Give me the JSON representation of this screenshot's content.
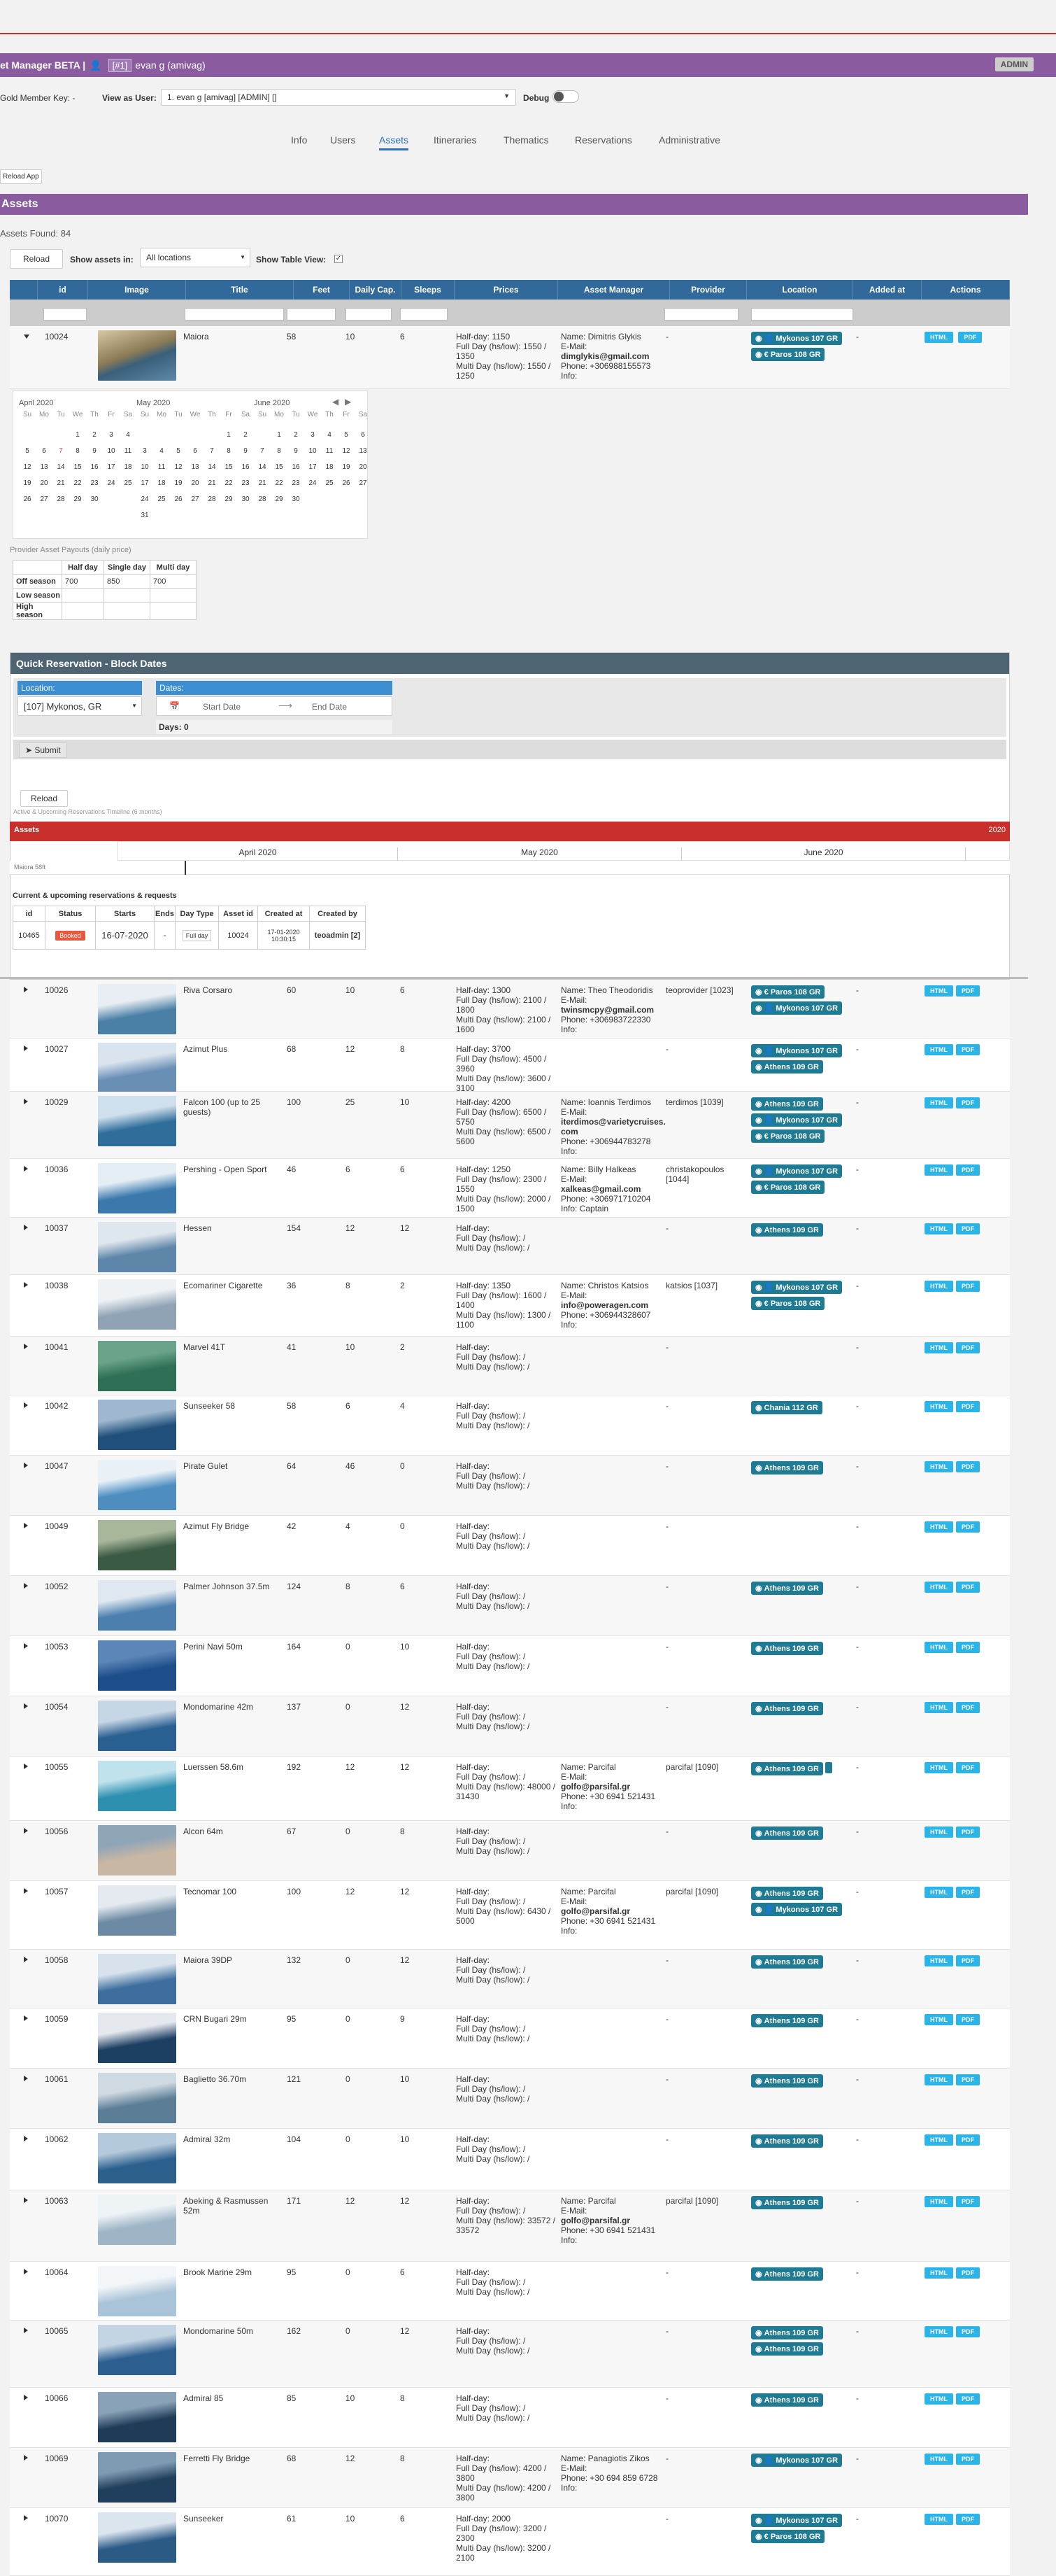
{
  "header": {
    "app_title": "et Manager BETA |",
    "user_tag": "[#1]",
    "user_name": "evan g (amivag)",
    "admin_badge": "ADMIN"
  },
  "controls": {
    "member_key_label": "Gold Member Key: -",
    "view_as_label": "View as User:",
    "view_as_value": "1. evan g [amivag] [ADMIN] []",
    "debug_label": "Debug"
  },
  "nav": {
    "tabs": [
      "Info",
      "Users",
      "Assets",
      "Itineraries",
      "Thematics",
      "Reservations",
      "Administrative"
    ],
    "active": "Assets",
    "reload_app": "Reload App"
  },
  "assets": {
    "section_title": "Assets",
    "found": "Assets Found: 84",
    "reload": "Reload",
    "show_in_label": "Show assets in:",
    "show_in_value": "All locations",
    "table_view_label": "Show Table View:"
  },
  "table": {
    "columns": [
      "id",
      "Image",
      "Title",
      "Feet",
      "Daily Cap.",
      "Sleeps",
      "Prices",
      "Asset Manager",
      "Provider",
      "Location",
      "Added at",
      "Actions"
    ],
    "btn_html": "HTML",
    "btn_pdf": "PDF"
  },
  "expanded": {
    "id": "10024",
    "title": "Maiora",
    "feet": "58",
    "cap": "10",
    "sleeps": "6",
    "prices": {
      "half": "Half-day: 1150",
      "full": "Full Day (hs/low): 1550 / 1350",
      "multi": "Multi Day (hs/low): 1550 / 1250"
    },
    "manager": {
      "name": "Name: Dimitris Glykis",
      "email_l": "E-Mail:",
      "email": "dimglykis@gmail.com",
      "phone": "Phone: +306988155573",
      "info": "Info:"
    },
    "provider": "-",
    "locations": [
      "Mykonos 107 GR",
      "Paros 108 GR"
    ],
    "added": "-"
  },
  "calendar": {
    "months": [
      {
        "name": "April 2020",
        "lead": 3,
        "days": 30,
        "red": [
          7
        ]
      },
      {
        "name": "May 2020",
        "lead": 5,
        "days": 31,
        "red": []
      },
      {
        "name": "June 2020",
        "lead": 1,
        "days": 30,
        "red": []
      }
    ],
    "weekdays": [
      "Su",
      "Mo",
      "Tu",
      "We",
      "Th",
      "Fr",
      "Sa"
    ]
  },
  "payouts": {
    "title": "Provider Asset Payouts (daily price)",
    "cols": [
      "",
      "Half day",
      "Single day",
      "Multi day"
    ],
    "rows": [
      [
        "Off season",
        "700",
        "850",
        "700"
      ],
      [
        "Low season",
        "",
        "",
        ""
      ],
      [
        "High season",
        "",
        "",
        ""
      ]
    ]
  },
  "quick_res": {
    "title": "Quick Reservation - Block Dates",
    "location_label": "Location:",
    "location_value": "[107] Mykonos, GR",
    "dates_label": "Dates:",
    "start": "Start Date",
    "end": "End Date",
    "days": "Days: 0",
    "submit": "Submit"
  },
  "timeline": {
    "reload": "Reload",
    "caption": "Active & Upcoming Reservations Timeline (6 months)",
    "assets_label": "Assets",
    "year": "2020",
    "months": [
      "April 2020",
      "May 2020",
      "June 2020"
    ],
    "asset_row": "Maiora 58ft"
  },
  "reservations": {
    "title": "Current & upcoming reservations & requests",
    "cols": [
      "id",
      "Status",
      "Starts",
      "Ends",
      "Day Type",
      "Asset id",
      "Created at",
      "Created by"
    ],
    "row": [
      "10465",
      "Booked",
      "16-07-2020",
      "-",
      "Full day",
      "10024",
      "17-01-2020 10:30:15",
      "teoadmin [2]"
    ]
  },
  "rows": [
    {
      "id": "10026",
      "title": "Riva Corsaro",
      "feet": "60",
      "cap": "10",
      "sleeps": "6",
      "half": "Half-day: 1300",
      "full": "Full Day (hs/low): 2100 / 1800",
      "multi": "Multi Day (hs/low): 2100 / 1600",
      "mgr": [
        "Name: Theo Theodoridis",
        "E-Mail:",
        "twinsmcpy@gmail.com",
        "Phone: +306983722330",
        "Info:"
      ],
      "prov": "teoprovider [1023]",
      "locs": [
        "Paros 108 GR",
        "Mykonos 107 GR"
      ],
      "img": [
        "#4a7fa6",
        "#e8eef3"
      ]
    },
    {
      "id": "10027",
      "title": "Azimut Plus",
      "feet": "68",
      "cap": "12",
      "sleeps": "8",
      "half": "Half-day: 3700",
      "full": "Full Day (hs/low): 4500 / 3960",
      "multi": "Multi Day (hs/low): 3600 / 3100",
      "mgr": [],
      "prov": "-",
      "locs": [
        "Mykonos 107 GR",
        "Athens 109 GR"
      ],
      "img": [
        "#6a8fb5",
        "#d9e4ee"
      ]
    },
    {
      "id": "10029",
      "title": "Falcon 100 (up to 25 guests)",
      "feet": "100",
      "cap": "25",
      "sleeps": "10",
      "half": "Half-day: 4200",
      "full": "Full Day (hs/low): 6500 / 5750",
      "multi": "Multi Day (hs/low): 6500 / 5600",
      "mgr": [
        "Name: Ioannis Terdimos",
        "E-Mail:",
        "iterdimos@varietycruises.com",
        "Phone: +306944783278",
        "Info:"
      ],
      "prov": "terdimos [1039]",
      "locs": [
        "Athens 109 GR",
        "Mykonos 107 GR",
        "Paros 108 GR"
      ],
      "img": [
        "#2f6d9a",
        "#cfe0ec"
      ]
    },
    {
      "id": "10036",
      "title": "Pershing - Open Sport",
      "feet": "46",
      "cap": "6",
      "sleeps": "6",
      "half": "Half-day: 1250",
      "full": "Full Day (hs/low): 2300 / 1550",
      "multi": "Multi Day (hs/low): 2000 / 1500",
      "mgr": [
        "Name: Billy Halkeas",
        "E-Mail:",
        "xalkeas@gmail.com",
        "Phone: +306971710204",
        "Info: Captain"
      ],
      "prov": "christakopoulos [1044]",
      "locs": [
        "Mykonos 107 GR",
        "Paros 108 GR"
      ],
      "img": [
        "#3b79ad",
        "#e6eef5"
      ]
    },
    {
      "id": "10037",
      "title": "Hessen",
      "feet": "154",
      "cap": "12",
      "sleeps": "12",
      "half": "Half-day:",
      "full": "Full Day (hs/low): /",
      "multi": "Multi Day (hs/low): /",
      "mgr": [],
      "prov": "-",
      "locs": [
        "Athens 109 GR"
      ],
      "img": [
        "#5e86a8",
        "#dfe7ee"
      ]
    },
    {
      "id": "10038",
      "title": "Ecomariner Cigarette",
      "feet": "36",
      "cap": "8",
      "sleeps": "2",
      "half": "Half-day: 1350",
      "full": "Full Day (hs/low): 1600 / 1400",
      "multi": "Multi Day (hs/low): 1300 / 1100",
      "mgr": [
        "Name: Christos Katsios",
        "E-Mail:",
        "info@poweragen.com",
        "Phone: +306944328607",
        "Info:"
      ],
      "prov": "katsios [1037]",
      "locs": [
        "Mykonos 107 GR",
        "Paros 108 GR"
      ],
      "img": [
        "#8fa3b5",
        "#eef2f5"
      ]
    },
    {
      "id": "10041",
      "title": "Marvel 41T",
      "feet": "41",
      "cap": "10",
      "sleeps": "2",
      "half": "Half-day:",
      "full": "Full Day (hs/low): /",
      "multi": "Multi Day (hs/low): /",
      "mgr": [],
      "prov": "-",
      "locs": [],
      "img": [
        "#2e6f55",
        "#6aa38a"
      ]
    },
    {
      "id": "10042",
      "title": "Sunseeker 58",
      "feet": "58",
      "cap": "6",
      "sleeps": "4",
      "half": "Half-day:",
      "full": "Full Day (hs/low): /",
      "multi": "Multi Day (hs/low): /",
      "mgr": [],
      "prov": "-",
      "locs": [
        "Chania 112 GR"
      ],
      "img": [
        "#1f4f7a",
        "#9fb8cf"
      ]
    },
    {
      "id": "10047",
      "title": "Pirate Gulet",
      "feet": "64",
      "cap": "46",
      "sleeps": "0",
      "half": "Half-day:",
      "full": "Full Day (hs/low): /",
      "multi": "Multi Day (hs/low): /",
      "mgr": [],
      "prov": "-",
      "locs": [
        "Athens 109 GR"
      ],
      "img": [
        "#4d8dc0",
        "#e9f1f7"
      ]
    },
    {
      "id": "10049",
      "title": "Azimut Fly Bridge",
      "feet": "42",
      "cap": "4",
      "sleeps": "0",
      "half": "Half-day:",
      "full": "Full Day (hs/low): /",
      "multi": "Multi Day (hs/low): /",
      "mgr": [],
      "prov": "-",
      "locs": [],
      "img": [
        "#3a5a44",
        "#a8b79a"
      ]
    },
    {
      "id": "10052",
      "title": "Palmer Johnson 37.5m",
      "feet": "124",
      "cap": "8",
      "sleeps": "6",
      "half": "Half-day:",
      "full": "Full Day (hs/low): /",
      "multi": "Multi Day (hs/low): /",
      "mgr": [],
      "prov": "-",
      "locs": [
        "Athens 109 GR"
      ],
      "img": [
        "#4c7fae",
        "#dfe8f0"
      ]
    },
    {
      "id": "10053",
      "title": "Perini Navi 50m",
      "feet": "164",
      "cap": "0",
      "sleeps": "10",
      "half": "Half-day:",
      "full": "Full Day (hs/low): /",
      "multi": "Multi Day (hs/low): /",
      "mgr": [],
      "prov": "-",
      "locs": [
        "Athens 109 GR"
      ],
      "img": [
        "#1d4e8a",
        "#5d86b8"
      ]
    },
    {
      "id": "10054",
      "title": "Mondomarine 42m",
      "feet": "137",
      "cap": "0",
      "sleeps": "12",
      "half": "Half-day:",
      "full": "Full Day (hs/low): /",
      "multi": "Multi Day (hs/low): /",
      "mgr": [],
      "prov": "-",
      "locs": [
        "Athens 109 GR"
      ],
      "img": [
        "#2a5f92",
        "#c6d6e4"
      ]
    },
    {
      "id": "10055",
      "title": "Luerssen 58.6m",
      "feet": "192",
      "cap": "12",
      "sleeps": "12",
      "half": "Half-day:",
      "full": "Full Day (hs/low): /",
      "multi": "Multi Day (hs/low): 48000 / 31430",
      "mgr": [
        "Name: Parcifal",
        "E-Mail:",
        "golfo@parsifal.gr",
        "Phone: +30 6941 521431",
        "Info:"
      ],
      "prov": "parcifal [1090]",
      "locs": [
        "Athens 109 GR"
      ],
      "img": [
        "#2f8fb0",
        "#bfe2ec"
      ]
    },
    {
      "id": "10056",
      "title": "Alcon 64m",
      "feet": "67",
      "cap": "0",
      "sleeps": "8",
      "half": "Half-day:",
      "full": "Full Day (hs/low): /",
      "multi": "Multi Day (hs/low): /",
      "mgr": [],
      "prov": "-",
      "locs": [
        "Athens 109 GR"
      ],
      "img": [
        "#c7b7a3",
        "#8fa5b8"
      ]
    },
    {
      "id": "10057",
      "title": "Tecnomar 100",
      "feet": "100",
      "cap": "12",
      "sleeps": "12",
      "half": "Half-day:",
      "full": "Full Day (hs/low): /",
      "multi": "Multi Day (hs/low): 6430 / 5000",
      "mgr": [
        "Name: Parcifal",
        "E-Mail:",
        "golfo@parsifal.gr",
        "Phone: +30 6941 521431",
        "Info:"
      ],
      "prov": "parcifal [1090]",
      "locs": [
        "Athens 109 GR",
        "Mykonos 107 GR"
      ],
      "img": [
        "#6d8aa4",
        "#e4eaef"
      ]
    },
    {
      "id": "10058",
      "title": "Maiora 39DP",
      "feet": "132",
      "cap": "0",
      "sleeps": "12",
      "half": "Half-day:",
      "full": "Full Day (hs/low): /",
      "multi": "Multi Day (hs/low): /",
      "mgr": [],
      "prov": "-",
      "locs": [
        "Athens 109 GR"
      ],
      "img": [
        "#3d6e9e",
        "#d7e2ec"
      ]
    },
    {
      "id": "10059",
      "title": "CRN Bugari 29m",
      "feet": "95",
      "cap": "0",
      "sleeps": "9",
      "half": "Half-day:",
      "full": "Full Day (hs/low): /",
      "multi": "Multi Day (hs/low): /",
      "mgr": [],
      "prov": "-",
      "locs": [
        "Athens 109 GR"
      ],
      "img": [
        "#1d3f62",
        "#e5e9ee"
      ]
    },
    {
      "id": "10061",
      "title": "Baglietto 36.70m",
      "feet": "121",
      "cap": "0",
      "sleeps": "10",
      "half": "Half-day:",
      "full": "Full Day (hs/low): /",
      "multi": "Multi Day (hs/low): /",
      "mgr": [],
      "prov": "-",
      "locs": [
        "Athens 109 GR"
      ],
      "img": [
        "#5b7d96",
        "#cfd9e1"
      ]
    },
    {
      "id": "10062",
      "title": "Admiral 32m",
      "feet": "104",
      "cap": "0",
      "sleeps": "10",
      "half": "Half-day:",
      "full": "Full Day (hs/low): /",
      "multi": "Multi Day (hs/low): /",
      "mgr": [],
      "prov": "-",
      "locs": [
        "Athens 109 GR"
      ],
      "img": [
        "#2b5f8c",
        "#b4c9db"
      ]
    },
    {
      "id": "10063",
      "title": "Abeking & Rasmussen 52m",
      "feet": "171",
      "cap": "12",
      "sleeps": "12",
      "half": "Half-day:",
      "full": "Full Day (hs/low): /",
      "multi": "Multi Day (hs/low): 33572 / 33572",
      "mgr": [
        "Name: Parcifal",
        "E-Mail:",
        "golfo@parsifal.gr",
        "Phone: +30 6941 521431",
        "Info:"
      ],
      "prov": "parcifal [1090]",
      "locs": [
        "Athens 109 GR"
      ],
      "img": [
        "#9db5c7",
        "#eef3f6"
      ]
    },
    {
      "id": "10064",
      "title": "Brook Marine 29m",
      "feet": "95",
      "cap": "0",
      "sleeps": "6",
      "half": "Half-day:",
      "full": "Full Day (hs/low): /",
      "multi": "Multi Day (hs/low): /",
      "mgr": [],
      "prov": "-",
      "locs": [
        "Athens 109 GR"
      ],
      "img": [
        "#a9c3d8",
        "#f3f6f8"
      ]
    },
    {
      "id": "10065",
      "title": "Mondomarine 50m",
      "feet": "162",
      "cap": "0",
      "sleeps": "12",
      "half": "Half-day:",
      "full": "Full Day (hs/low): /",
      "multi": "Multi Day (hs/low): /",
      "mgr": [],
      "prov": "-",
      "locs": [
        "Athens 109 GR",
        "Athens 109 GR"
      ],
      "img": [
        "#2c5e8f",
        "#c3d4e3"
      ]
    },
    {
      "id": "10066",
      "title": "Admiral 85",
      "feet": "85",
      "cap": "10",
      "sleeps": "8",
      "half": "Half-day:",
      "full": "Full Day (hs/low): /",
      "multi": "Multi Day (hs/low): /",
      "mgr": [],
      "prov": "-",
      "locs": [
        "Athens 109 GR"
      ],
      "img": [
        "#1f3b57",
        "#8aa2b8"
      ]
    },
    {
      "id": "10069",
      "title": "Ferretti Fly Bridge",
      "feet": "68",
      "cap": "12",
      "sleeps": "8",
      "half": "Half-day:",
      "full": "Full Day (hs/low): 4200 / 3800",
      "multi": "Multi Day (hs/low): 4200 / 3800",
      "mgr": [
        "Name: Panagiotis Zikos",
        "E-Mail:",
        "Phone: +30 694 859 6728",
        "Info:"
      ],
      "prov": "-",
      "locs": [
        "Mykonos 107 GR"
      ],
      "img": [
        "#203f5c",
        "#7f9bb3"
      ]
    },
    {
      "id": "10070",
      "title": "Sunseeker",
      "feet": "61",
      "cap": "10",
      "sleeps": "6",
      "half": "Half-day: 2000",
      "full": "Full Day (hs/low): 3200 / 2300",
      "multi": "Multi Day (hs/low): 3200 / 2100",
      "mgr": [],
      "prov": "-",
      "locs": [
        "Mykonos 107 GR",
        "Paros 108 GR"
      ],
      "img": [
        "#2b5a85",
        "#dbe5ee"
      ]
    }
  ],
  "colors": {
    "header": "#8a5c9f",
    "table_head": "#30699a",
    "location_badge": "#1f7b94",
    "action_button": "#2ab4e8",
    "timeline_red": "#c9302c"
  }
}
